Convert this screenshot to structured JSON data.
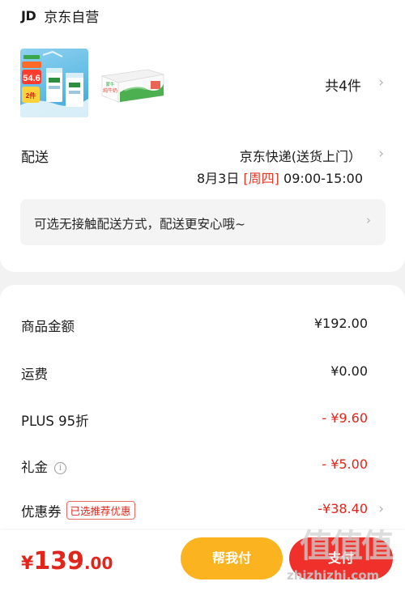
{
  "shop": {
    "logo": "JD",
    "name": "京东自营"
  },
  "products": {
    "count_label": "共4件",
    "items": [
      {
        "icon": "milk-carton-promo-image",
        "price_tag": "54.6",
        "promo_tag": "2件"
      },
      {
        "icon": "milk-gift-box-image",
        "label": "纯牛奶"
      }
    ]
  },
  "shipping": {
    "label": "配送",
    "method": "京东快递(送货上门）",
    "date": "8月3日 ",
    "weekday": "[周四]",
    "time": " 09:00-15:00"
  },
  "notice": {
    "text": "可选无接触配送方式，配送更安心哦~"
  },
  "summary": {
    "rows": [
      {
        "label": "商品金额",
        "value": "¥192.00"
      },
      {
        "label": "运费",
        "value": "¥0.00"
      },
      {
        "label": "PLUS 95折",
        "value": "- ¥9.60"
      },
      {
        "label": "礼金",
        "value": "- ¥5.00"
      },
      {
        "label": "优惠券",
        "value": "-¥38.40",
        "badge": "已选推荐优惠"
      }
    ]
  },
  "footer": {
    "currency": "¥",
    "amount_int": "139",
    "amount_dec": ".00",
    "help_pay_label": "帮我付",
    "pay_label": "支付"
  },
  "watermark": {
    "glyphs": "值值值",
    "url": "zhizhizhi.com"
  },
  "colors": {
    "accent_red": "#e1251b",
    "help_button": "#fbb320",
    "pay_button": "#f0302b"
  }
}
